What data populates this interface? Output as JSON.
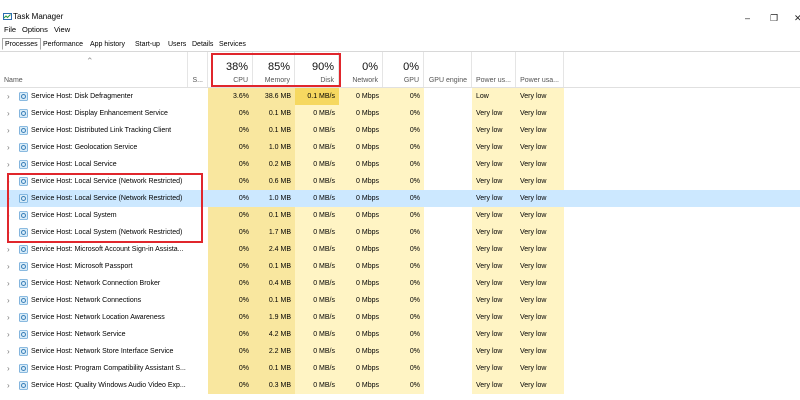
{
  "window": {
    "title": "Task Manager",
    "minimize_icon": "minimize-icon",
    "maximize_icon": "restore-icon",
    "close_icon": "close-icon"
  },
  "menu": [
    "File",
    "Options",
    "View"
  ],
  "tabs": [
    {
      "label": "Processes",
      "active": true
    },
    {
      "label": "Performance"
    },
    {
      "label": "App history"
    },
    {
      "label": "Start-up"
    },
    {
      "label": "Users"
    },
    {
      "label": "Details"
    },
    {
      "label": "Services"
    }
  ],
  "columns": {
    "name": {
      "label": "Name"
    },
    "status": {
      "label": "S..."
    },
    "cpu": {
      "label": "CPU",
      "pct": "38%"
    },
    "memory": {
      "label": "Memory",
      "pct": "85%"
    },
    "disk": {
      "label": "Disk",
      "pct": "90%"
    },
    "network": {
      "label": "Network",
      "pct": "0%"
    },
    "gpu": {
      "label": "GPU",
      "pct": "0%"
    },
    "gpu_engine": {
      "label": "GPU engine"
    },
    "power": {
      "label": "Power us..."
    },
    "power_trend": {
      "label": "Power usa..."
    }
  },
  "rows": [
    {
      "name": "Service Host: Disk Defragmenter",
      "cpu": "3.6%",
      "memory": "38.6 MB",
      "disk": "0.1 MB/s",
      "network": "0 Mbps",
      "gpu": "0%",
      "power": "Low",
      "power_trend": "Very low"
    },
    {
      "name": "Service Host: Display Enhancement Service",
      "cpu": "0%",
      "memory": "0.1 MB",
      "disk": "0 MB/s",
      "network": "0 Mbps",
      "gpu": "0%",
      "power": "Very low",
      "power_trend": "Very low"
    },
    {
      "name": "Service Host: Distributed Link Tracking Client",
      "cpu": "0%",
      "memory": "0.1 MB",
      "disk": "0 MB/s",
      "network": "0 Mbps",
      "gpu": "0%",
      "power": "Very low",
      "power_trend": "Very low"
    },
    {
      "name": "Service Host: Geolocation Service",
      "cpu": "0%",
      "memory": "1.0 MB",
      "disk": "0 MB/s",
      "network": "0 Mbps",
      "gpu": "0%",
      "power": "Very low",
      "power_trend": "Very low"
    },
    {
      "name": "Service Host: Local Service",
      "cpu": "0%",
      "memory": "0.2 MB",
      "disk": "0 MB/s",
      "network": "0 Mbps",
      "gpu": "0%",
      "power": "Very low",
      "power_trend": "Very low"
    },
    {
      "name": "Service Host: Local Service (Network Restricted)",
      "cpu": "0%",
      "memory": "0.6 MB",
      "disk": "0 MB/s",
      "network": "0 Mbps",
      "gpu": "0%",
      "power": "Very low",
      "power_trend": "Very low"
    },
    {
      "name": "Service Host: Local Service (Network Restricted)",
      "cpu": "0%",
      "memory": "1.0 MB",
      "disk": "0 MB/s",
      "network": "0 Mbps",
      "gpu": "0%",
      "power": "Very low",
      "power_trend": "Very low",
      "selected": true
    },
    {
      "name": "Service Host: Local System",
      "cpu": "0%",
      "memory": "0.1 MB",
      "disk": "0 MB/s",
      "network": "0 Mbps",
      "gpu": "0%",
      "power": "Very low",
      "power_trend": "Very low"
    },
    {
      "name": "Service Host: Local System (Network Restricted)",
      "cpu": "0%",
      "memory": "1.7 MB",
      "disk": "0 MB/s",
      "network": "0 Mbps",
      "gpu": "0%",
      "power": "Very low",
      "power_trend": "Very low"
    },
    {
      "name": "Service Host: Microsoft Account Sign-in Assista...",
      "cpu": "0%",
      "memory": "2.4 MB",
      "disk": "0 MB/s",
      "network": "0 Mbps",
      "gpu": "0%",
      "power": "Very low",
      "power_trend": "Very low"
    },
    {
      "name": "Service Host: Microsoft Passport",
      "cpu": "0%",
      "memory": "0.1 MB",
      "disk": "0 MB/s",
      "network": "0 Mbps",
      "gpu": "0%",
      "power": "Very low",
      "power_trend": "Very low"
    },
    {
      "name": "Service Host: Network Connection Broker",
      "cpu": "0%",
      "memory": "0.4 MB",
      "disk": "0 MB/s",
      "network": "0 Mbps",
      "gpu": "0%",
      "power": "Very low",
      "power_trend": "Very low"
    },
    {
      "name": "Service Host: Network Connections",
      "cpu": "0%",
      "memory": "0.1 MB",
      "disk": "0 MB/s",
      "network": "0 Mbps",
      "gpu": "0%",
      "power": "Very low",
      "power_trend": "Very low"
    },
    {
      "name": "Service Host: Network Location Awareness",
      "cpu": "0%",
      "memory": "1.9 MB",
      "disk": "0 MB/s",
      "network": "0 Mbps",
      "gpu": "0%",
      "power": "Very low",
      "power_trend": "Very low"
    },
    {
      "name": "Service Host: Network Service",
      "cpu": "0%",
      "memory": "4.2 MB",
      "disk": "0 MB/s",
      "network": "0 Mbps",
      "gpu": "0%",
      "power": "Very low",
      "power_trend": "Very low"
    },
    {
      "name": "Service Host: Network Store Interface Service",
      "cpu": "0%",
      "memory": "2.2 MB",
      "disk": "0 MB/s",
      "network": "0 Mbps",
      "gpu": "0%",
      "power": "Very low",
      "power_trend": "Very low"
    },
    {
      "name": "Service Host: Program Compatibility Assistant S...",
      "cpu": "0%",
      "memory": "0.1 MB",
      "disk": "0 MB/s",
      "network": "0 Mbps",
      "gpu": "0%",
      "power": "Very low",
      "power_trend": "Very low"
    },
    {
      "name": "Service Host: Quality Windows Audio Video Exp...",
      "cpu": "0%",
      "memory": "0.3 MB",
      "disk": "0 MB/s",
      "network": "0 Mbps",
      "gpu": "0%",
      "power": "Very low",
      "power_trend": "Very low"
    }
  ],
  "colors": {
    "heat_light": "#fff4c4",
    "heat_mid": "#f9e79f",
    "selected_row": "#cce8ff",
    "annotation_red": "#e0262c"
  }
}
